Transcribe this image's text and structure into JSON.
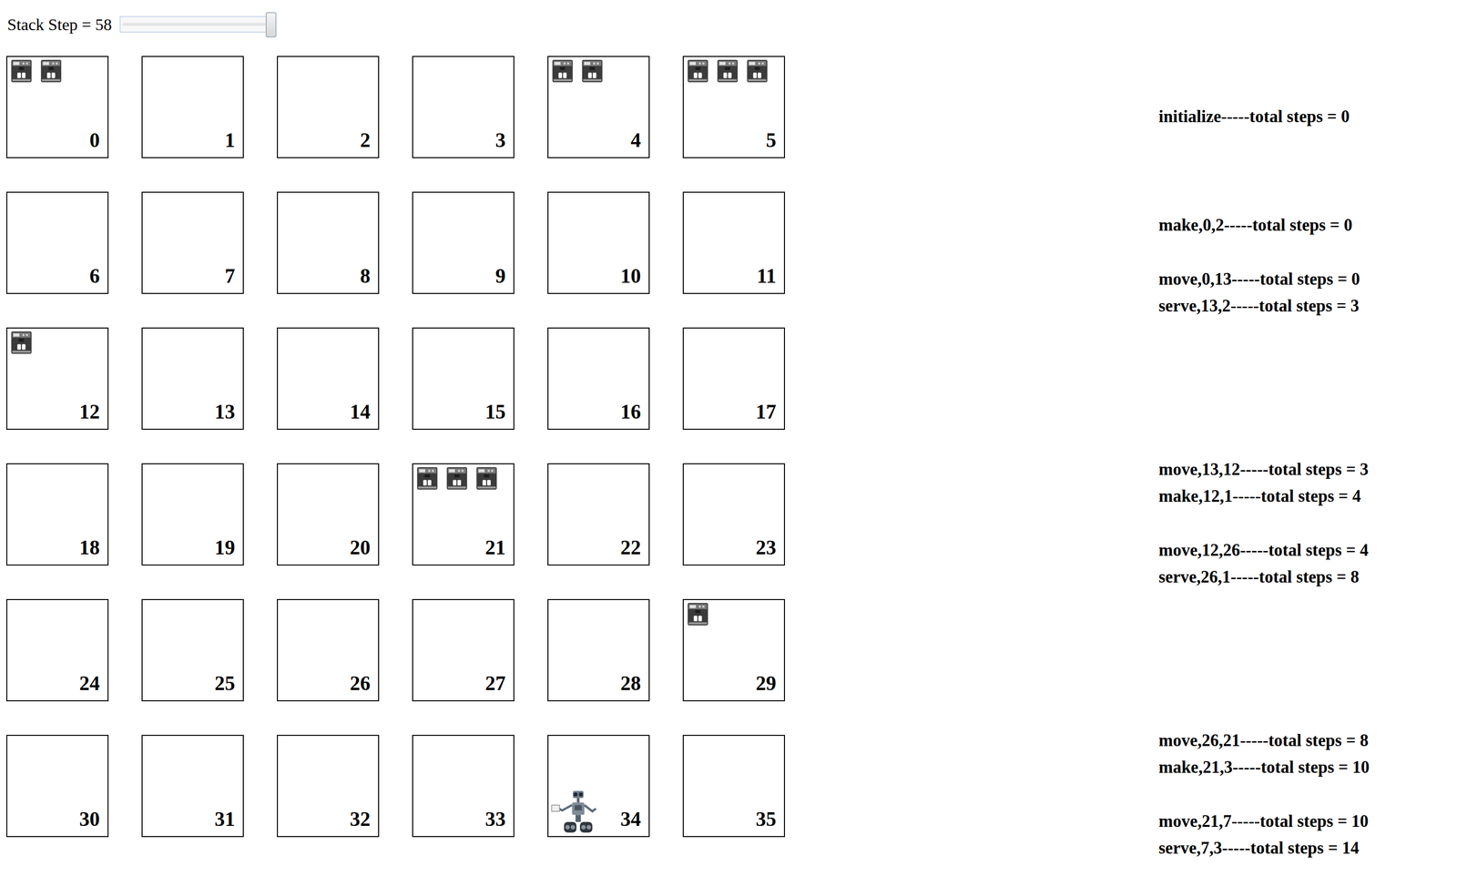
{
  "slider": {
    "label": "Stack Step = 58",
    "level": 1
  },
  "cells": [
    {
      "label": "0",
      "machines": 2,
      "robot": false
    },
    {
      "label": "1",
      "machines": 0,
      "robot": false
    },
    {
      "label": "2",
      "machines": 0,
      "robot": false
    },
    {
      "label": "3",
      "machines": 0,
      "robot": false
    },
    {
      "label": "4",
      "machines": 2,
      "robot": false
    },
    {
      "label": "5",
      "machines": 3,
      "robot": false
    },
    {
      "label": "6",
      "machines": 0,
      "robot": false
    },
    {
      "label": "7",
      "machines": 0,
      "robot": false
    },
    {
      "label": "8",
      "machines": 0,
      "robot": false
    },
    {
      "label": "9",
      "machines": 0,
      "robot": false
    },
    {
      "label": "10",
      "machines": 0,
      "robot": false
    },
    {
      "label": "11",
      "machines": 0,
      "robot": false
    },
    {
      "label": "12",
      "machines": 1,
      "robot": false
    },
    {
      "label": "13",
      "machines": 0,
      "robot": false
    },
    {
      "label": "14",
      "machines": 0,
      "robot": false
    },
    {
      "label": "15",
      "machines": 0,
      "robot": false
    },
    {
      "label": "16",
      "machines": 0,
      "robot": false
    },
    {
      "label": "17",
      "machines": 0,
      "robot": false
    },
    {
      "label": "18",
      "machines": 0,
      "robot": false
    },
    {
      "label": "19",
      "machines": 0,
      "robot": false
    },
    {
      "label": "20",
      "machines": 0,
      "robot": false
    },
    {
      "label": "21",
      "machines": 3,
      "robot": false
    },
    {
      "label": "22",
      "machines": 0,
      "robot": false
    },
    {
      "label": "23",
      "machines": 0,
      "robot": false
    },
    {
      "label": "24",
      "machines": 0,
      "robot": false
    },
    {
      "label": "25",
      "machines": 0,
      "robot": false
    },
    {
      "label": "26",
      "machines": 0,
      "robot": false
    },
    {
      "label": "27",
      "machines": 0,
      "robot": false
    },
    {
      "label": "28",
      "machines": 0,
      "robot": false
    },
    {
      "label": "29",
      "machines": 1,
      "robot": false
    },
    {
      "label": "30",
      "machines": 0,
      "robot": false
    },
    {
      "label": "31",
      "machines": 0,
      "robot": false
    },
    {
      "label": "32",
      "machines": 0,
      "robot": false
    },
    {
      "label": "33",
      "machines": 0,
      "robot": false
    },
    {
      "label": "34",
      "machines": 0,
      "robot": true
    },
    {
      "label": "35",
      "machines": 0,
      "robot": false
    }
  ],
  "log": {
    "initial": "initialize-----total steps = 0",
    "groups": [
      {
        "blocks": [
          [
            "make,0,2-----total steps = 0"
          ],
          [
            "move,0,13-----total steps = 0",
            "serve,13,2-----total steps = 3"
          ]
        ]
      },
      {
        "blocks": [
          [
            "move,13,12-----total steps = 3",
            "make,12,1-----total steps = 4"
          ],
          [
            "move,12,26-----total steps = 4",
            "serve,26,1-----total steps = 8"
          ]
        ]
      },
      {
        "blocks": [
          [
            "move,26,21-----total steps = 8",
            "make,21,3-----total steps = 10"
          ],
          [
            "move,21,7-----total steps = 10",
            "serve,7,3-----total steps = 14"
          ]
        ]
      }
    ]
  }
}
